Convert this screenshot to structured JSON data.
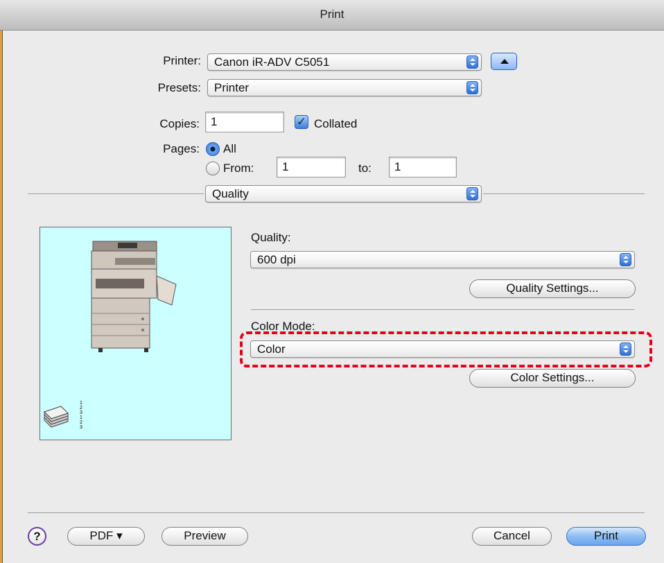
{
  "window": {
    "title": "Print"
  },
  "printer": {
    "label": "Printer:",
    "value": "Canon iR-ADV C5051"
  },
  "presets": {
    "label": "Presets:",
    "value": "Printer"
  },
  "copies": {
    "label": "Copies:",
    "value": "1",
    "collated_label": "Collated",
    "collated_checked": true
  },
  "pages": {
    "label": "Pages:",
    "all_label": "All",
    "from_label": "From:",
    "from_value": "1",
    "to_label": "to:",
    "to_value": "1",
    "selected": "All"
  },
  "panel_selector": {
    "value": "Quality"
  },
  "quality": {
    "label": "Quality:",
    "value": "600 dpi",
    "settings_button": "Quality Settings..."
  },
  "color_mode": {
    "label": "Color Mode:",
    "value": "Color",
    "settings_button": "Color Settings..."
  },
  "page_order_labels": [
    "1",
    "2",
    "3",
    "1",
    "2",
    "3"
  ],
  "footer": {
    "help": "?",
    "pdf": "PDF ▾",
    "preview": "Preview",
    "cancel": "Cancel",
    "print": "Print"
  },
  "colors": {
    "accent": "#3676d6",
    "preview_bg": "#ccffff",
    "highlight": "#e3001b",
    "background": "#ebebeb"
  }
}
